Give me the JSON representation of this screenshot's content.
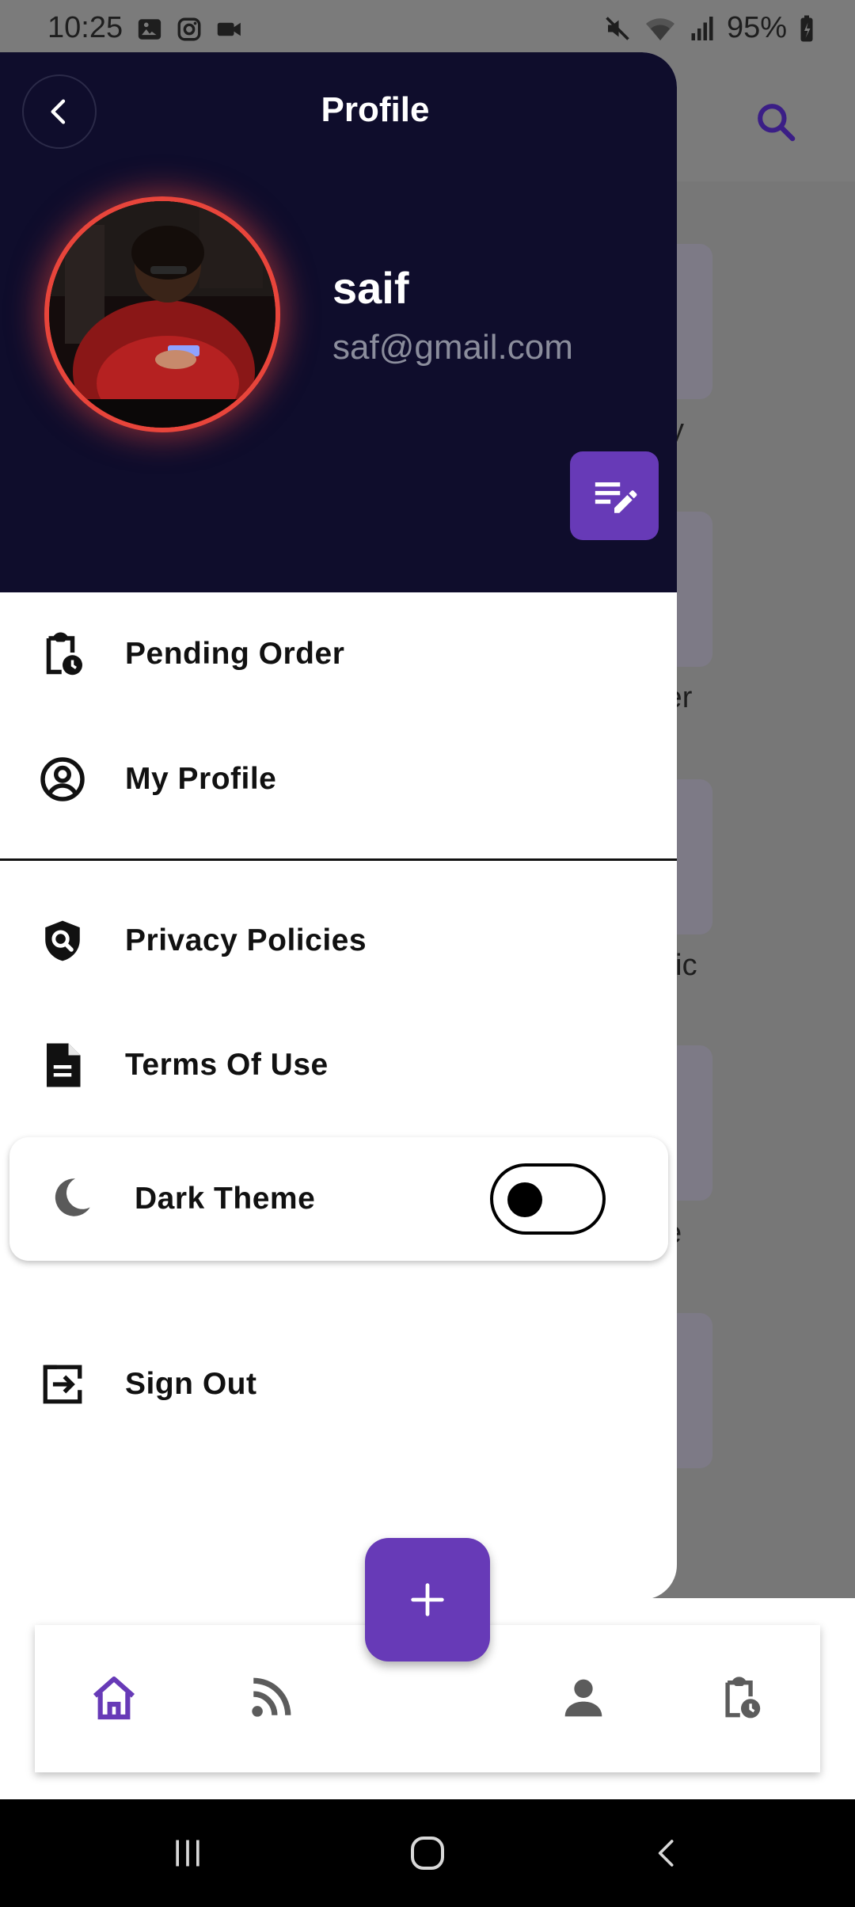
{
  "status_bar": {
    "time": "10:25",
    "battery": "95%",
    "left_icons": [
      "gallery-icon",
      "instagram-icon",
      "video-icon"
    ],
    "right_icons": [
      "mute-icon",
      "wifi-icon",
      "signal-icon",
      "battery-icon"
    ]
  },
  "background": {
    "texts": [
      "y",
      "ter",
      "nic",
      "e"
    ]
  },
  "drawer": {
    "title": "Profile",
    "user": {
      "name": "saif",
      "email": "saf@gmail.com"
    },
    "menu": [
      {
        "label": "Pending Order",
        "icon": "clipboard-clock-icon"
      },
      {
        "label": "My Profile",
        "icon": "account-circle-icon"
      },
      {
        "label": "Privacy Policies",
        "icon": "shield-search-icon"
      },
      {
        "label": "Terms Of Use",
        "icon": "document-icon"
      }
    ],
    "theme": {
      "label": "Dark Theme",
      "enabled": false
    },
    "sign_out": {
      "label": "Sign Out",
      "icon": "logout-icon"
    }
  },
  "bottom_nav": {
    "active": "home",
    "items": [
      "home-icon",
      "feed-icon",
      "person-icon",
      "clipboard-clock-icon"
    ],
    "fab_icon": "plus-icon"
  },
  "colors": {
    "header_bg": "#0f0d2c",
    "accent": "#673ab7",
    "avatar_ring": "#e8453b",
    "email": "#8b8d9c"
  }
}
